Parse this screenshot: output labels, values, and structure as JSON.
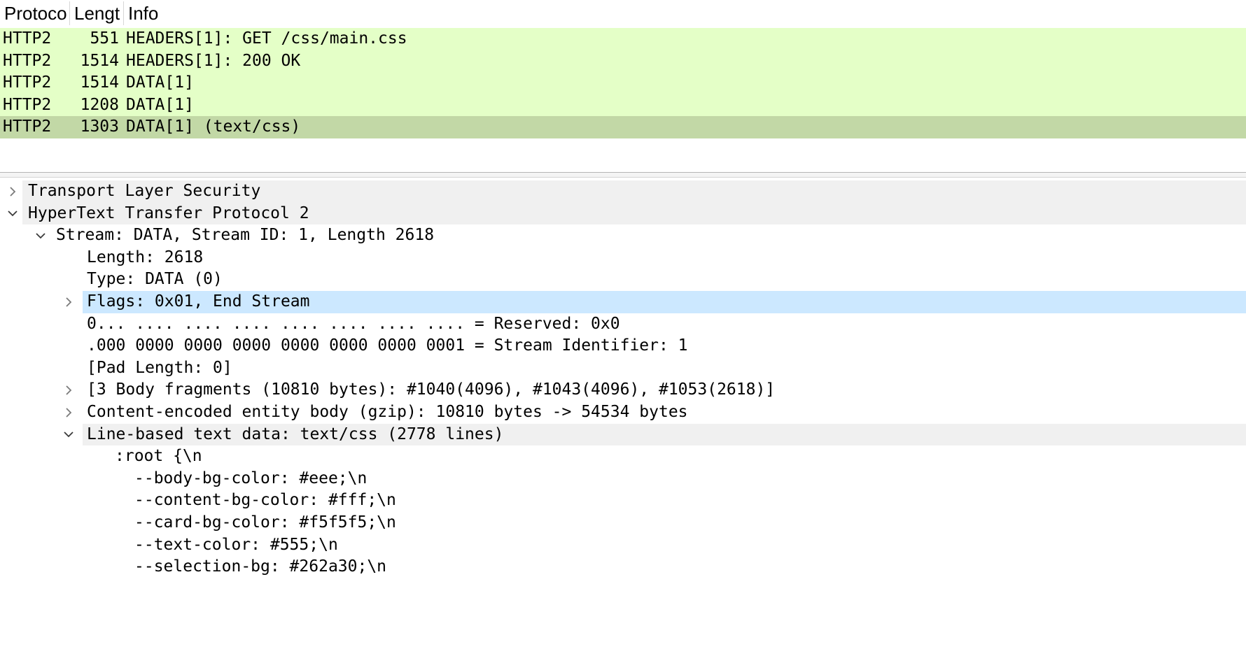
{
  "packet_list": {
    "columns": {
      "protocol": "Protoco",
      "length": "Lengt",
      "info": "Info"
    },
    "rows": [
      {
        "protocol": "HTTP2",
        "length": "551",
        "info": "HEADERS[1]: GET /css/main.css"
      },
      {
        "protocol": "HTTP2",
        "length": "1514",
        "info": "HEADERS[1]: 200 OK"
      },
      {
        "protocol": "HTTP2",
        "length": "1514",
        "info": "DATA[1]"
      },
      {
        "protocol": "HTTP2",
        "length": "1208",
        "info": "DATA[1]"
      },
      {
        "protocol": "HTTP2",
        "length": "1303",
        "info": "DATA[1] (text/css)"
      }
    ],
    "selected_index": 4
  },
  "details": [
    {
      "text": "Transport Layer Security",
      "state": "collapsed"
    },
    {
      "text": "HyperText Transfer Protocol 2",
      "state": "expanded"
    },
    {
      "text": "Stream: DATA, Stream ID: 1, Length 2618",
      "state": "expanded"
    },
    {
      "text": "Length: 2618",
      "state": "leaf"
    },
    {
      "text": "Type: DATA (0)",
      "state": "leaf"
    },
    {
      "text": "Flags: 0x01, End Stream",
      "state": "collapsed"
    },
    {
      "text": "0... .... .... .... .... .... .... .... = Reserved: 0x0",
      "state": "leaf"
    },
    {
      "text": ".000 0000 0000 0000 0000 0000 0000 0001 = Stream Identifier: 1",
      "state": "leaf"
    },
    {
      "text": "[Pad Length: 0]",
      "state": "leaf"
    },
    {
      "text": "[3 Body fragments (10810 bytes): #1040(4096), #1043(4096), #1053(2618)]",
      "state": "collapsed"
    },
    {
      "text": "Content-encoded entity body (gzip): 10810 bytes -> 54534 bytes",
      "state": "collapsed"
    },
    {
      "text": "Line-based text data: text/css (2778 lines)",
      "state": "expanded"
    },
    {
      "text": ":root {\\n",
      "state": "leaf"
    },
    {
      "text": "--body-bg-color: #eee;\\n",
      "state": "leaf"
    },
    {
      "text": "--content-bg-color: #fff;\\n",
      "state": "leaf"
    },
    {
      "text": "--card-bg-color: #f5f5f5;\\n",
      "state": "leaf"
    },
    {
      "text": "--text-color: #555;\\n",
      "state": "leaf"
    },
    {
      "text": "--selection-bg: #262a30;\\n",
      "state": "leaf"
    }
  ],
  "colors": {
    "row_bg": "#e4ffc7",
    "row_selected_bg": "#c2d8a6",
    "detail_selected_bg": "#cce8ff",
    "detail_hover_bg": "#f0f0f0"
  },
  "icons": {
    "collapsed": "chevron-right-icon",
    "expanded": "chevron-down-icon"
  }
}
